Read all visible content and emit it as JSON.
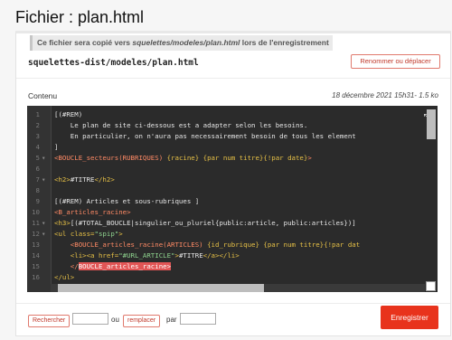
{
  "page": {
    "title": "Fichier : plan.html"
  },
  "notice": {
    "prefix": "Ce fichier sera copié vers ",
    "path": "squelettes/modeles/plan.html",
    "suffix": " lors de l'enregistrement"
  },
  "file": {
    "path": "squelettes-dist/modeles/plan.html",
    "rename_label": "Renommer ou déplacer",
    "contenu_label": "Contenu",
    "meta": "18 décembre 2021 15h31- 1.5 ko"
  },
  "editor": {
    "lines": [
      {
        "n": "1",
        "fold": "",
        "tokens": [
          {
            "t": "[(#REM)",
            "c": "t-comment"
          }
        ]
      },
      {
        "n": "2",
        "fold": "",
        "tokens": [
          {
            "t": "    Le plan de site ci-dessous est a adapter selon les besoins.",
            "c": "t-comment"
          }
        ]
      },
      {
        "n": "3",
        "fold": "",
        "tokens": [
          {
            "t": "    En particulier, on n'aura pas necessairement besoin de tous les element",
            "c": "t-comment"
          }
        ]
      },
      {
        "n": "4",
        "fold": "",
        "tokens": [
          {
            "t": "]",
            "c": "t-comment"
          }
        ]
      },
      {
        "n": "5",
        "fold": "▾",
        "tokens": [
          {
            "t": "<BOUCLE_secteurs(RUBRIQUES)",
            "c": "t-boucle"
          },
          {
            "t": " {racine} {par num titre}{!par date}",
            "c": "t-param"
          },
          {
            "t": ">",
            "c": "t-boucle"
          }
        ]
      },
      {
        "n": "6",
        "fold": "",
        "tokens": [
          {
            "t": "",
            "c": "t-comment"
          }
        ]
      },
      {
        "n": "7",
        "fold": "▾",
        "tokens": [
          {
            "t": "<h2>",
            "c": "t-tag"
          },
          {
            "t": "#TITRE",
            "c": "t-balise"
          },
          {
            "t": "</h2>",
            "c": "t-tag"
          }
        ]
      },
      {
        "n": "8",
        "fold": "",
        "tokens": [
          {
            "t": "",
            "c": "t-comment"
          }
        ]
      },
      {
        "n": "9",
        "fold": "",
        "tokens": [
          {
            "t": "[(#REM) Articles et sous-rubriques ]",
            "c": "t-comment"
          }
        ]
      },
      {
        "n": "10",
        "fold": "",
        "tokens": [
          {
            "t": "<B_articles_racine>",
            "c": "t-boucle"
          }
        ]
      },
      {
        "n": "11",
        "fold": "▾",
        "tokens": [
          {
            "t": "<h3>",
            "c": "t-tag"
          },
          {
            "t": "[(#TOTAL_BOUCLE|singulier_ou_pluriel{public:article, public:articles})]",
            "c": "t-balise"
          }
        ]
      },
      {
        "n": "12",
        "fold": "▾",
        "tokens": [
          {
            "t": "<ul ",
            "c": "t-tag"
          },
          {
            "t": "class=",
            "c": "t-param"
          },
          {
            "t": "\"spip\"",
            "c": "t-str"
          },
          {
            "t": ">",
            "c": "t-tag"
          }
        ]
      },
      {
        "n": "13",
        "fold": "",
        "tokens": [
          {
            "t": "    <BOUCLE_articles_racine(ARTICLES)",
            "c": "t-boucle"
          },
          {
            "t": " {id_rubrique} {par num titre}{!par dat",
            "c": "t-param"
          }
        ]
      },
      {
        "n": "14",
        "fold": "",
        "tokens": [
          {
            "t": "    <li><a ",
            "c": "t-tag"
          },
          {
            "t": "href=",
            "c": "t-param"
          },
          {
            "t": "\"#URL_ARTICLE\"",
            "c": "t-str"
          },
          {
            "t": ">",
            "c": "t-tag"
          },
          {
            "t": "#TITRE",
            "c": "t-balise"
          },
          {
            "t": "</a></li>",
            "c": "t-tag"
          }
        ]
      },
      {
        "n": "15",
        "fold": "",
        "tokens": [
          {
            "t": "    </",
            "c": "t-boucle"
          },
          {
            "t": "BOUCLE_articles_racine>",
            "c": "hl"
          }
        ]
      },
      {
        "n": "16",
        "fold": "",
        "tokens": [
          {
            "t": "</ul>",
            "c": "t-tag"
          }
        ]
      }
    ]
  },
  "search": {
    "rechercher_label": "Rechercher",
    "search_value": "",
    "ou_label": "ou",
    "remplacer_label": "remplacer",
    "par_label": "par",
    "replace_value": ""
  },
  "save_label": "Enregistrer"
}
